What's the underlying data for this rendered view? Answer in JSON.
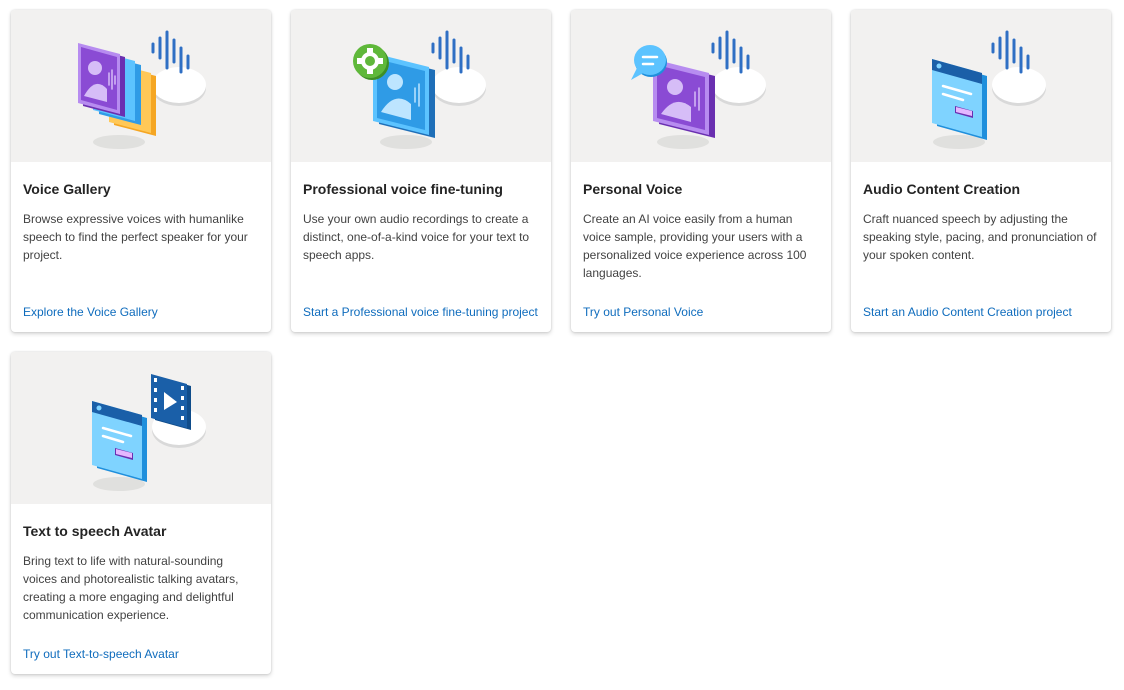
{
  "cards": [
    {
      "title": "Voice Gallery",
      "description": "Browse expressive voices with humanlike speech to find the perfect speaker for your project.",
      "link": "Explore the Voice Gallery",
      "illustration": "voice-gallery-illustration"
    },
    {
      "title": "Professional voice fine-tuning",
      "description": "Use your own audio recordings to create a distinct, one-of-a-kind voice for your text to speech apps.",
      "link": "Start a Professional voice fine-tuning project",
      "illustration": "professional-voice-illustration"
    },
    {
      "title": "Personal Voice",
      "description": "Create an AI voice easily from a human voice sample, providing your users with a personalized voice experience across 100 languages.",
      "link": "Try out Personal Voice",
      "illustration": "personal-voice-illustration"
    },
    {
      "title": "Audio Content Creation",
      "description": "Craft nuanced speech by adjusting the speaking style, pacing, and pronunciation of your spoken content.",
      "link": "Start an Audio Content Creation project",
      "illustration": "audio-content-illustration"
    },
    {
      "title": "Text to speech Avatar",
      "description": "Bring text to life with natural-sounding voices and photorealistic talking avatars, creating a more engaging and delightful communication experience.",
      "link": "Try out Text-to-speech Avatar",
      "illustration": "avatar-illustration"
    }
  ],
  "colors": {
    "media_background": "#f2f1f0",
    "link": "#0f6cbd",
    "title": "#242424",
    "description": "#424242",
    "purple": "#8a4bd4",
    "blue": "#2f9be6",
    "orange": "#f5a623",
    "green": "#5fb83a"
  }
}
